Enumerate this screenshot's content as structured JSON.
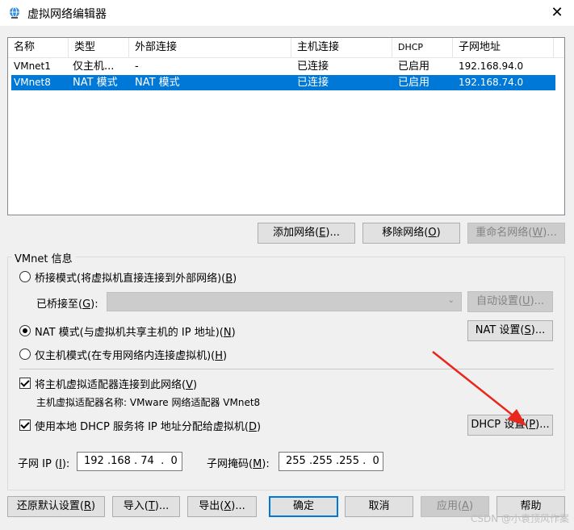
{
  "window": {
    "title": "虚拟网络编辑器",
    "close_glyph": "✕",
    "icon": "network-globe-icon"
  },
  "list": {
    "columns": [
      "名称",
      "类型",
      "外部连接",
      "主机连接",
      "DHCP",
      "子网地址"
    ],
    "rows": [
      {
        "name": "VMnet1",
        "type": "仅主机...",
        "external": "-",
        "host": "已连接",
        "dhcp": "已启用",
        "subnet": "192.168.94.0",
        "selected": false
      },
      {
        "name": "VMnet8",
        "type": "NAT 模式",
        "external": "NAT 模式",
        "host": "已连接",
        "dhcp": "已启用",
        "subnet": "192.168.74.0",
        "selected": true
      }
    ]
  },
  "list_buttons": {
    "add": {
      "pre": "添加网络(",
      "key": "E",
      "post": ")..."
    },
    "remove": {
      "pre": "移除网络(",
      "key": "O",
      "post": ")"
    },
    "rename": {
      "pre": "重命名网络(",
      "key": "W",
      "post": ")..."
    }
  },
  "info": {
    "group_label": "VMnet 信息",
    "bridge": {
      "pre": "桥接模式(将虚拟机直接连接到外部网络)(",
      "key": "B",
      "post": ")"
    },
    "bridged_to": {
      "pre": "已桥接至(",
      "key": "G",
      "post": "):"
    },
    "auto_settings": {
      "pre": "自动设置(",
      "key": "U",
      "post": ")..."
    },
    "nat": {
      "pre": "NAT 模式(与虚拟机共享主机的 IP 地址)(",
      "key": "N",
      "post": ")"
    },
    "nat_settings": {
      "pre": "NAT 设置(",
      "key": "S",
      "post": ")..."
    },
    "hostonly": {
      "pre": "仅主机模式(在专用网络内连接虚拟机)(",
      "key": "H",
      "post": ")"
    },
    "connect_adapter": {
      "pre": "将主机虚拟适配器连接到此网络(",
      "key": "V",
      "post": ")"
    },
    "adapter_name": "主机虚拟适配器名称: VMware 网络适配器 VMnet8",
    "use_dhcp": {
      "pre": "使用本地 DHCP 服务将 IP 地址分配给虚拟机(",
      "key": "D",
      "post": ")"
    },
    "dhcp_settings": {
      "pre": "DHCP 设置(",
      "key": "P",
      "post": ")..."
    },
    "subnet_ip_label": {
      "pre": "子网 IP (",
      "key": "I",
      "post": "):"
    },
    "subnet_ip_value": "192 .168 . 74  .  0",
    "subnet_mask_label": {
      "pre": "子网掩码(",
      "key": "M",
      "post": "):"
    },
    "subnet_mask_value": "255 .255 .255 .  0",
    "selected_mode": "nat",
    "connect_adapter_checked": true,
    "use_dhcp_checked": true
  },
  "footer": {
    "restore": {
      "pre": "还原默认设置(",
      "key": "R",
      "post": ")"
    },
    "import": {
      "pre": "导入(",
      "key": "T",
      "post": ")..."
    },
    "export": {
      "pre": "导出(",
      "key": "X",
      "post": ")..."
    },
    "ok": "确定",
    "cancel": "取消",
    "apply": {
      "pre": "应用(",
      "key": "A",
      "post": ")"
    },
    "help": "帮助"
  },
  "watermark": "CSDN @小袁顶风作案",
  "colors": {
    "selection": "#0078d7",
    "arrow": "#e8261c"
  }
}
